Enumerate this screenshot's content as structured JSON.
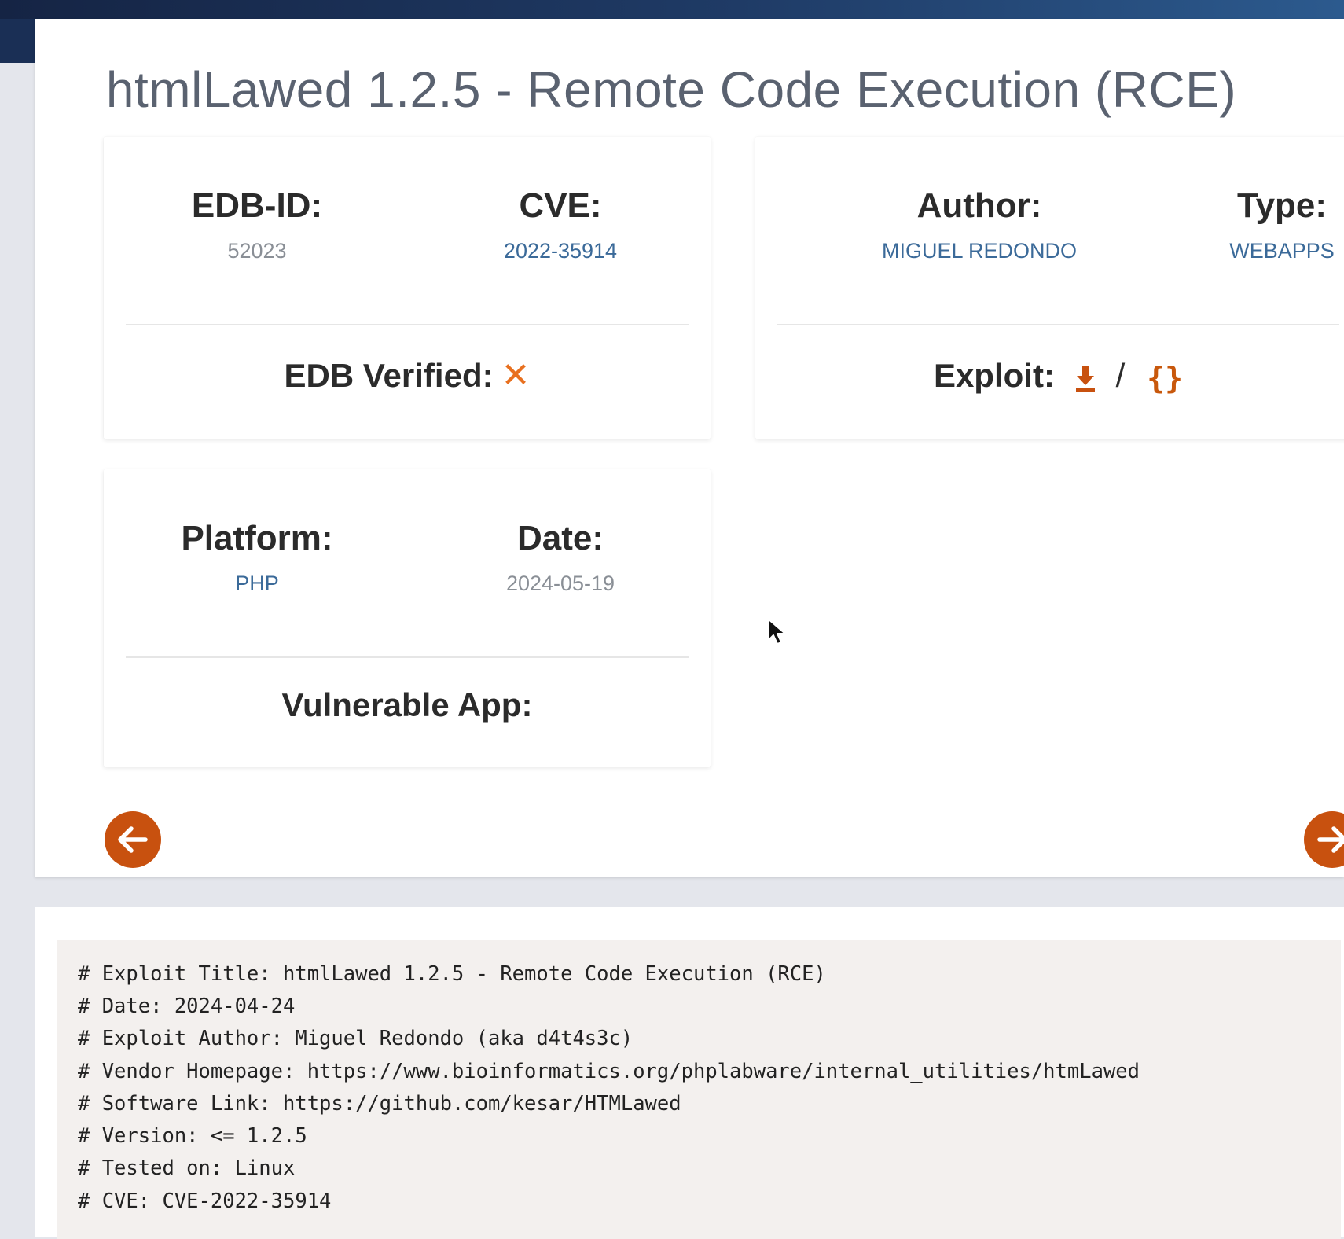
{
  "page": {
    "title": "htmlLawed 1.2.5 - Remote Code Execution (RCE)"
  },
  "details": {
    "edb_id": {
      "label": "EDB-ID:",
      "value": "52023"
    },
    "cve": {
      "label": "CVE:",
      "value": "2022-35914"
    },
    "author": {
      "label": "Author:",
      "value": "MIGUEL REDONDO"
    },
    "type": {
      "label": "Type:",
      "value": "WEBAPPS"
    },
    "platform": {
      "label": "Platform:",
      "value": "PHP"
    },
    "date": {
      "label": "Date:",
      "value": "2024-05-19"
    },
    "edb_verified": {
      "label": "EDB Verified:",
      "icon": "x-icon",
      "verified": false
    },
    "exploit": {
      "label": "Exploit:",
      "separator": "/",
      "download_icon": "download-icon",
      "raw_icon": "braces-icon",
      "raw_text": "{}"
    },
    "vulnerable_app": {
      "label": "Vulnerable App:"
    }
  },
  "navigation": {
    "prev_icon": "arrow-left-icon",
    "next_icon": "arrow-right-icon"
  },
  "code": {
    "lines": [
      "# Exploit Title: htmlLawed 1.2.5 - Remote Code Execution (RCE)",
      "# Date: 2024-04-24",
      "# Exploit Author: Miguel Redondo (aka d4t4s3c)",
      "# Vendor Homepage: https://www.bioinformatics.org/phplabware/internal_utilities/htmLawed",
      "# Software Link: https://github.com/kesar/HTMLawed",
      "# Version: <= 1.2.5",
      "# Tested on: Linux",
      "# CVE: CVE-2022-35914"
    ]
  },
  "colors": {
    "accent": "#c8510f",
    "link": "#3b6a99",
    "x_mark": "#e8701f",
    "header": "#1f3b66"
  }
}
